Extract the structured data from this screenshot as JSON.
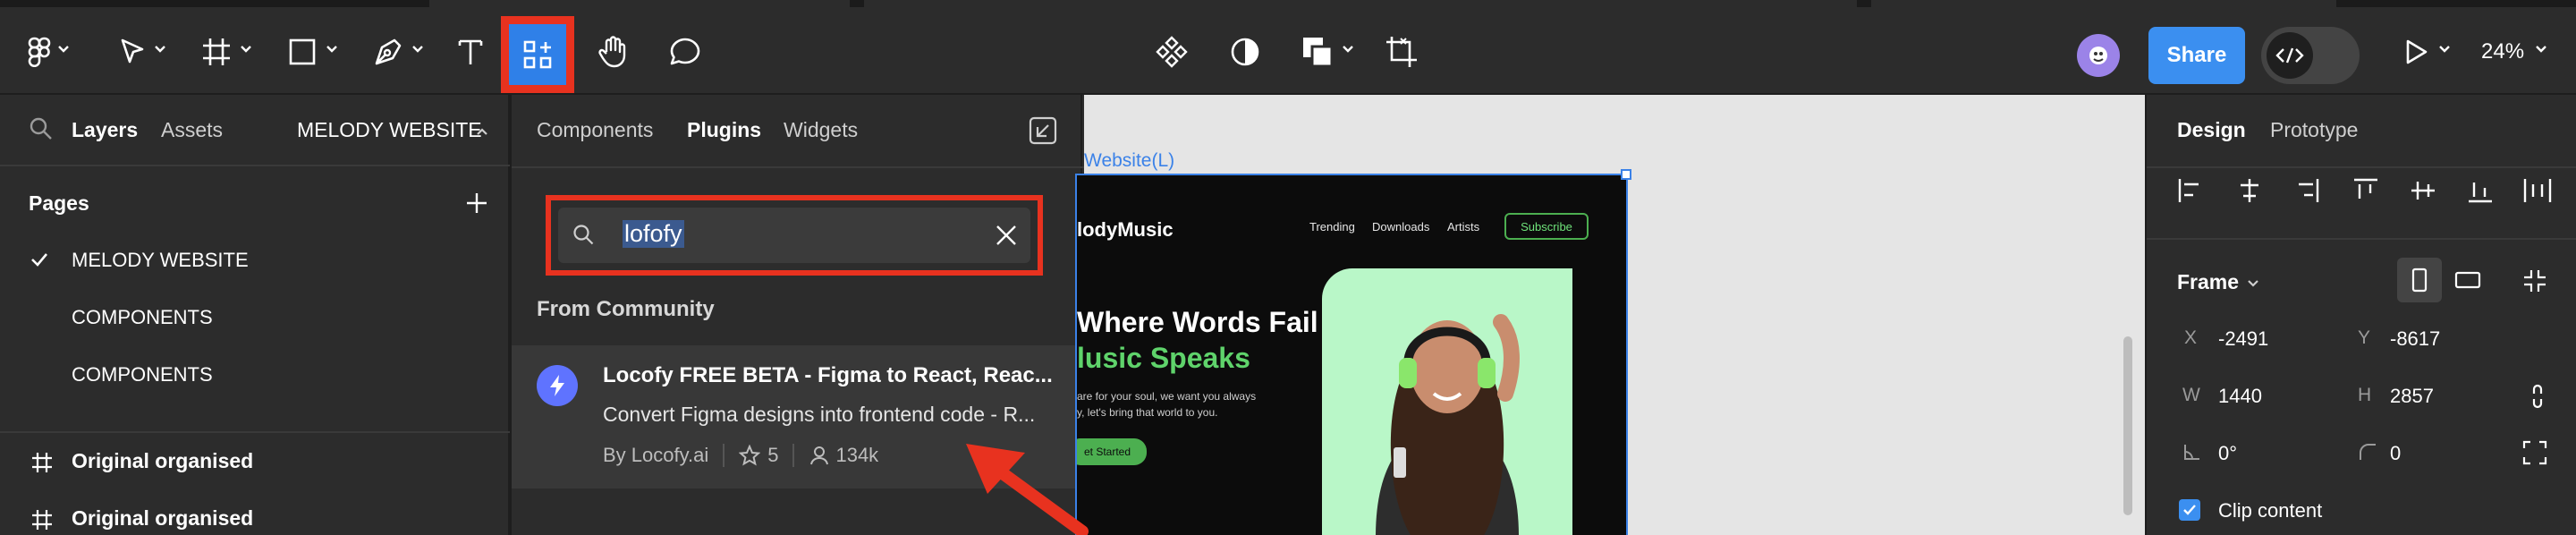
{
  "toolbar": {
    "share_label": "Share",
    "zoom": "24%"
  },
  "left_panel": {
    "tabs": [
      "Layers",
      "Assets"
    ],
    "file_name": "MELODY WEBSITE",
    "pages_heading": "Pages",
    "pages": [
      {
        "label": "MELODY WEBSITE",
        "current": true
      },
      {
        "label": "COMPONENTS",
        "current": false
      },
      {
        "label": "COMPONENTS",
        "current": false
      }
    ],
    "layers": [
      "Original organised",
      "Original organised"
    ]
  },
  "assets_popover": {
    "tabs": [
      {
        "label": "Components",
        "active": false
      },
      {
        "label": "Plugins",
        "active": true
      },
      {
        "label": "Widgets",
        "active": false
      }
    ],
    "search_value": "lofofy",
    "section_heading": "From Community",
    "result": {
      "title": "Locofy FREE BETA - Figma to React, Reac...",
      "description": "Convert Figma designs into frontend code - R...",
      "author": "By Locofy.ai",
      "stars": "5",
      "users": "134k"
    }
  },
  "canvas": {
    "frame_label": "Website(L)",
    "site": {
      "logo": "lodyMusic",
      "nav": [
        "Trending",
        "Downloads",
        "Artists"
      ],
      "subscribe": "Subscribe",
      "headline_1": "Where Words Fail",
      "headline_2": "lusic Speaks",
      "paragraph_1": "are for your soul, we want you always",
      "paragraph_2": "y, let's bring that world to you.",
      "cta": "et Started"
    }
  },
  "right_panel": {
    "tabs": [
      {
        "label": "Design",
        "active": true
      },
      {
        "label": "Prototype",
        "active": false
      }
    ],
    "section": "Frame",
    "x_label": "X",
    "x_value": "-2491",
    "y_label": "Y",
    "y_value": "-8617",
    "w_label": "W",
    "w_value": "1440",
    "h_label": "H",
    "h_value": "2857",
    "rotation": "0°",
    "radius": "0",
    "clip_content_label": "Clip content",
    "clip_content": true
  },
  "colors": {
    "accent": "#2f80e8",
    "highlight": "#e8321f",
    "share": "#3b8ff0",
    "hero_green": "#5fd36b",
    "card_green": "#b9f7c8"
  }
}
